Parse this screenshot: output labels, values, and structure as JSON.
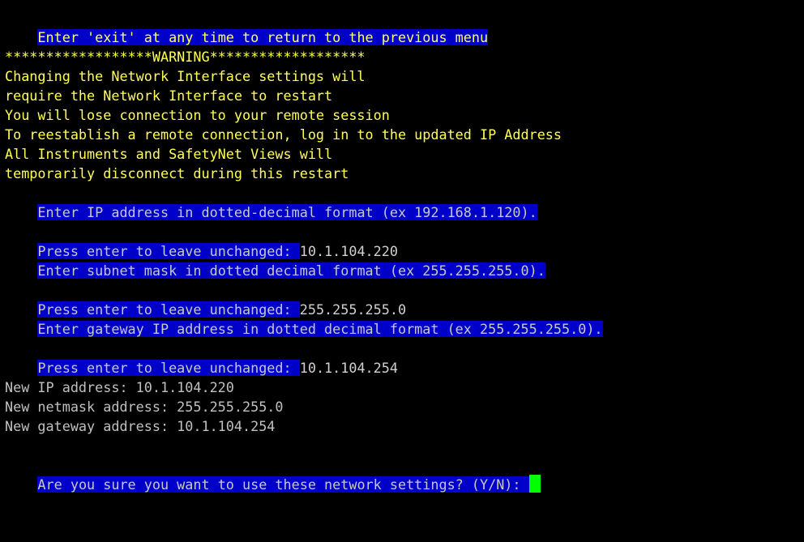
{
  "terminal": {
    "header": "Enter 'exit' at any time to return to the previous menu",
    "warning": {
      "banner": "******************WARNING*******************",
      "lines": [
        "Changing the Network Interface settings will",
        "require the Network Interface to restart",
        "You will lose connection to your remote session",
        "To reestablish a remote connection, log in to the updated IP Address",
        "All Instruments and SafetyNet Views will",
        "temporarily disconnect during this restart"
      ]
    },
    "ip_prompt": "Enter IP address in dotted-decimal format (ex 192.168.1.120).",
    "ip_leave_prompt": "Press enter to leave unchanged: ",
    "ip_value": "10.1.104.220",
    "subnet_prompt": "Enter subnet mask in dotted decimal format (ex 255.255.255.0).",
    "subnet_leave_prompt": "Press enter to leave unchanged: ",
    "subnet_value": "255.255.255.0",
    "gateway_prompt": "Enter gateway IP address in dotted decimal format (ex 255.255.255.0).",
    "gateway_leave_prompt": "Press enter to leave unchanged: ",
    "gateway_value": "10.1.104.254",
    "summary": [
      "New IP address: 10.1.104.220",
      "New netmask address: 255.255.255.0",
      "New gateway address: 10.1.104.254"
    ],
    "confirm_prompt": "Are you sure you want to use these network settings? (Y/N): "
  },
  "colors": {
    "background": "#000000",
    "highlight": "#0000c8",
    "warning_text": "#ffff55",
    "default_text": "#c0c0c0",
    "cursor": "#00ff00"
  }
}
